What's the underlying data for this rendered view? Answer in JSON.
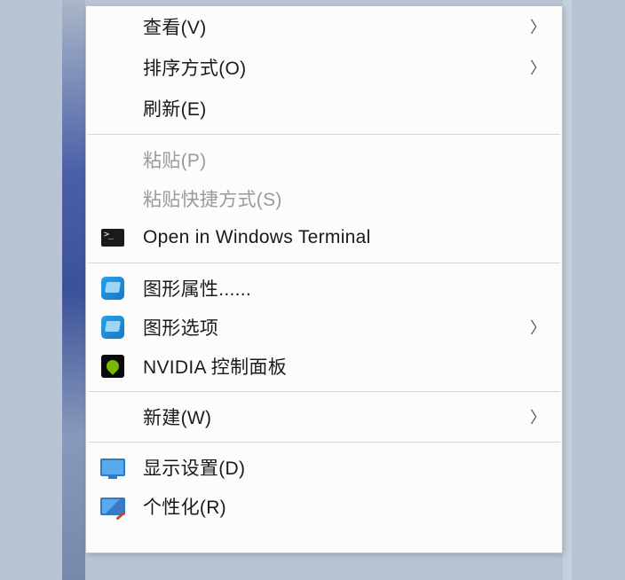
{
  "menu": {
    "view": {
      "label": "查看(V)",
      "has_submenu": true
    },
    "sort": {
      "label": "排序方式(O)",
      "has_submenu": true
    },
    "refresh": {
      "label": "刷新(E)",
      "has_submenu": false
    },
    "paste": {
      "label": "粘贴(P)",
      "disabled": true
    },
    "paste_shortcut": {
      "label": "粘贴快捷方式(S)",
      "disabled": true
    },
    "terminal": {
      "label": "Open in Windows Terminal"
    },
    "graphics_props": {
      "label": "图形属性......"
    },
    "graphics_options": {
      "label": "图形选项",
      "has_submenu": true
    },
    "nvidia": {
      "label": "NVIDIA 控制面板"
    },
    "new": {
      "label": "新建(W)",
      "has_submenu": true
    },
    "display_settings": {
      "label": "显示设置(D)"
    },
    "personalize": {
      "label": "个性化(R)"
    }
  }
}
